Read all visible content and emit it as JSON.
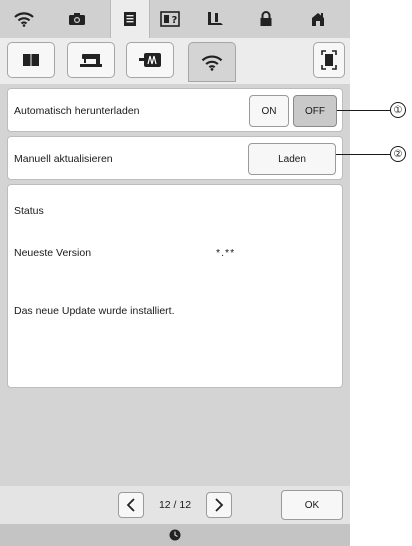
{
  "top_tabs": [
    {
      "icon": "wifi-icon"
    },
    {
      "icon": "camera-icon"
    },
    {
      "icon": "document-icon"
    },
    {
      "icon": "help-icon"
    },
    {
      "icon": "sewing-foot-icon"
    },
    {
      "icon": "lock-icon"
    },
    {
      "icon": "home-icon"
    }
  ],
  "sub_tabs": [
    {
      "icon": "book-icon"
    },
    {
      "icon": "sewing-machine-icon"
    },
    {
      "icon": "embroidery-icon"
    },
    {
      "icon": "wifi-icon"
    }
  ],
  "auto_download": {
    "label": "Automatisch herunterladen",
    "on_label": "ON",
    "off_label": "OFF",
    "selected": "OFF"
  },
  "manual_update": {
    "label": "Manuell aktualisieren",
    "button_label": "Laden"
  },
  "status": {
    "heading": "Status",
    "version_label": "Neueste Version",
    "version_value": "*.**",
    "message": "Das neue Update wurde installiert."
  },
  "pager": {
    "label": "12 / 12"
  },
  "ok_label": "OK",
  "callouts": [
    "①",
    "②"
  ],
  "colors": {
    "panel_bg": "#dcdcdc",
    "selected_button": "#c9c9c9"
  }
}
